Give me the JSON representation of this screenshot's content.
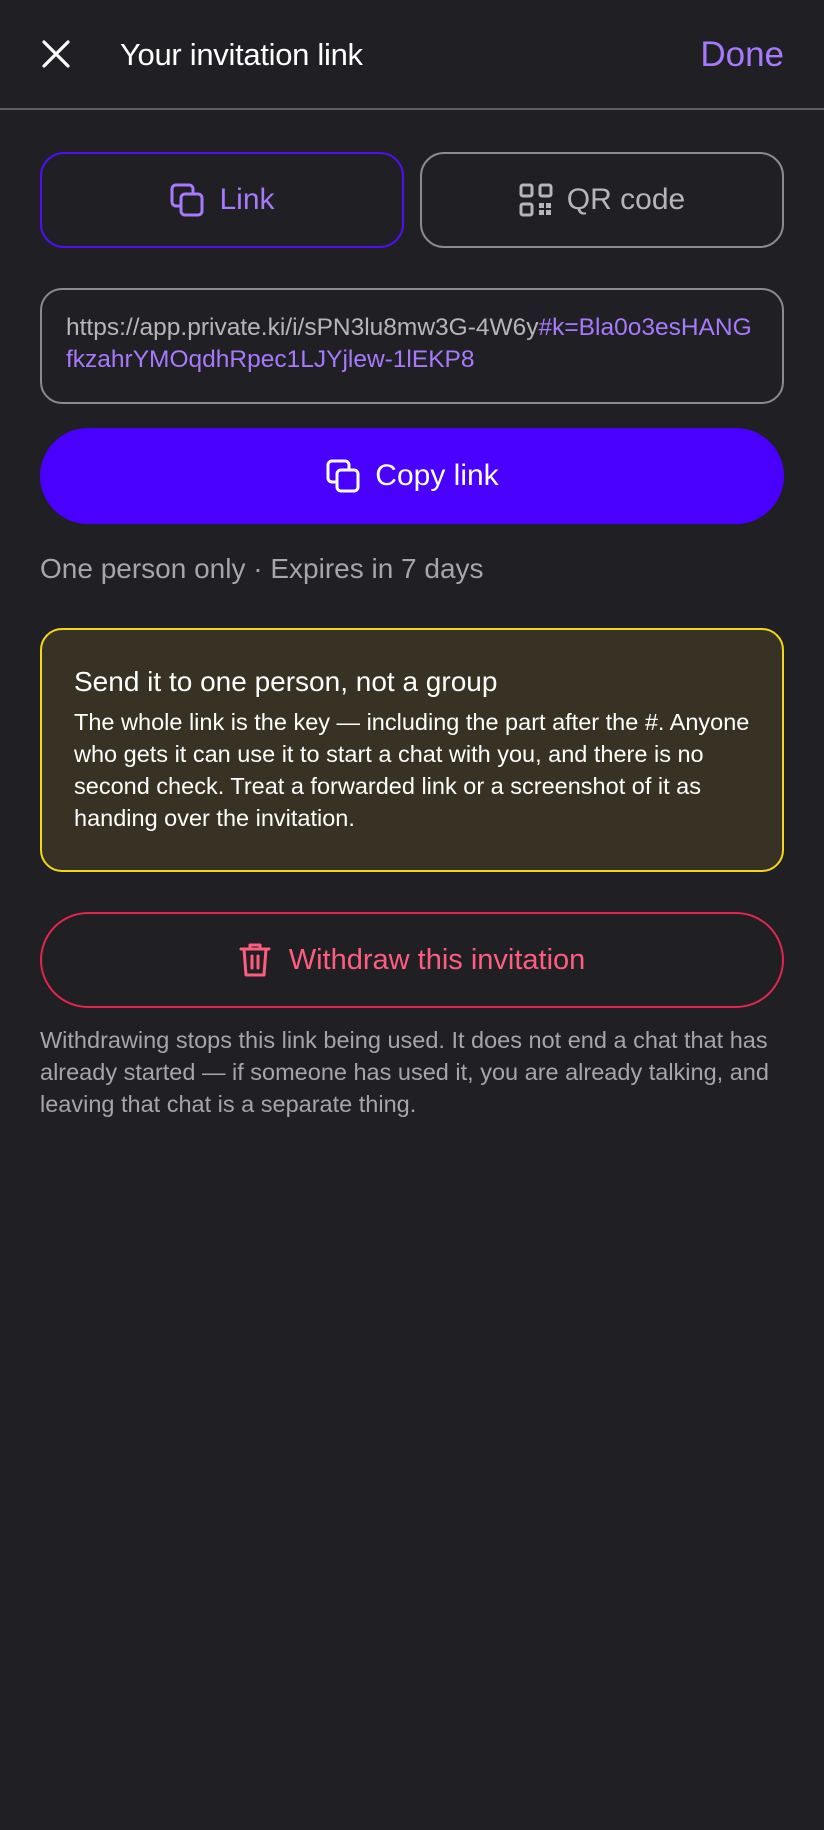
{
  "header": {
    "title": "Your invitation link",
    "done_label": "Done",
    "close_icon": "close-icon"
  },
  "tabs": [
    {
      "label": "Link",
      "icon": "copy-icon",
      "selected": true
    },
    {
      "label": "QR code",
      "icon": "qr-code-icon",
      "selected": false
    }
  ],
  "link": {
    "prefix": "https://app.private.ki/i/sPN3lu8mw3G-4W6y",
    "fragment": "#k=Bla0o3esHANGfkzahrYMOqdhRpec1LJYjlew-1lEKP8"
  },
  "copy_button": {
    "label": "Copy link",
    "icon": "copy-icon"
  },
  "meta": "One person only · Expires in 7 days",
  "warning": {
    "title": "Send it to one person, not a group",
    "body": "The whole link is the key — including the part after the #. Anyone who gets it can use it to start a chat with you, and there is no second check. Treat a forwarded link or a screenshot of it as handing over the invitation."
  },
  "withdraw": {
    "label": "Withdraw this invitation",
    "icon": "trash-icon",
    "note": "Withdrawing stops this link being used. It does not end a chat that has already started — if someone has used it, you are already talking, and leaving that chat is a separate thing."
  },
  "colors": {
    "background": "#1f1f24",
    "accent": "#a779fb",
    "primary_button": "#4a00ff",
    "warning_border": "#f4d61b",
    "danger": "#ff5d7f"
  }
}
